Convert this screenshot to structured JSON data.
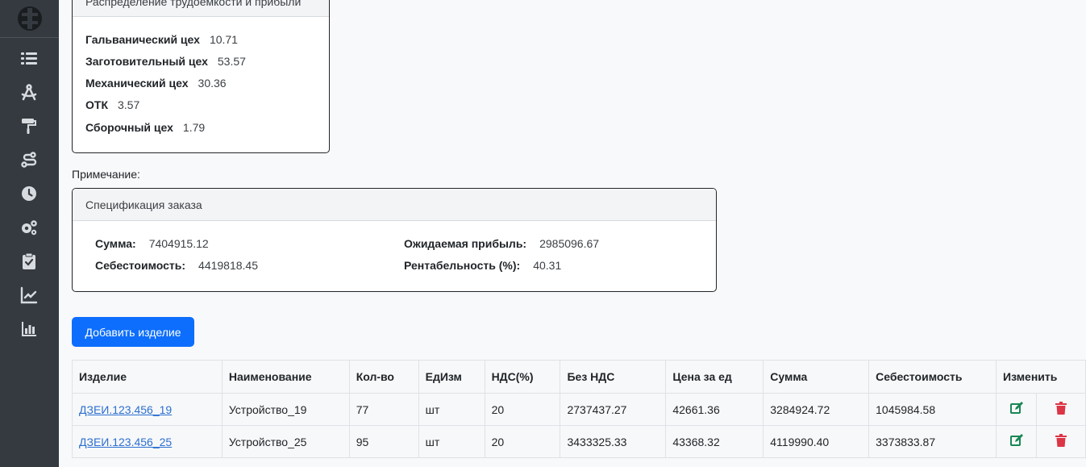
{
  "sidebar": {
    "icons": [
      "logo-icon",
      "list-icon",
      "compass-icon",
      "paint-roller-icon",
      "route-icon",
      "clock-icon",
      "cogs-icon",
      "clipboard-check-icon",
      "chart-line-icon",
      "chart-bar-icon"
    ]
  },
  "labor_card": {
    "title": "Распределение трудоемкости и прибыли",
    "rows": [
      {
        "label": "Гальванический цех",
        "value": "10.71"
      },
      {
        "label": "Заготовительный цех",
        "value": "53.57"
      },
      {
        "label": "Механический цех",
        "value": "30.36"
      },
      {
        "label": "ОТК",
        "value": "3.57"
      },
      {
        "label": "Сборочный цех",
        "value": "1.79"
      }
    ]
  },
  "note_label": "Примечание:",
  "spec_card": {
    "title": "Спецификация заказа",
    "sum_label": "Сумма:",
    "sum_value": "7404915.12",
    "cost_label": "Себестоимость:",
    "cost_value": "4419818.45",
    "profit_label": "Ожидаемая прибыль:",
    "profit_value": "2985096.67",
    "profitability_label": "Рентабельность (%):",
    "profitability_value": "40.31"
  },
  "add_button": "Добавить изделие",
  "table": {
    "headers": [
      "Изделие",
      "Наименование",
      "Кол-во",
      "ЕдИзм",
      "НДС(%)",
      "Без НДС",
      "Цена за ед",
      "Сумма",
      "Себестоимость",
      "Изменить"
    ],
    "rows": [
      {
        "item": "ДЗЕИ.123.456_19",
        "name": "Устройство_19",
        "qty": "77",
        "unit": "шт",
        "vat": "20",
        "no_vat": "2737437.27",
        "price": "42661.36",
        "sum": "3284924.72",
        "cost": "1045984.58"
      },
      {
        "item": "ДЗЕИ.123.456_25",
        "name": "Устройство_25",
        "qty": "95",
        "unit": "шт",
        "vat": "20",
        "no_vat": "3433325.33",
        "price": "43368.32",
        "sum": "4119990.40",
        "cost": "3373833.87"
      }
    ]
  },
  "colors": {
    "sidebar": "#343a40",
    "primary": "#0d6efd",
    "edit": "#198754",
    "delete": "#dc3545"
  }
}
